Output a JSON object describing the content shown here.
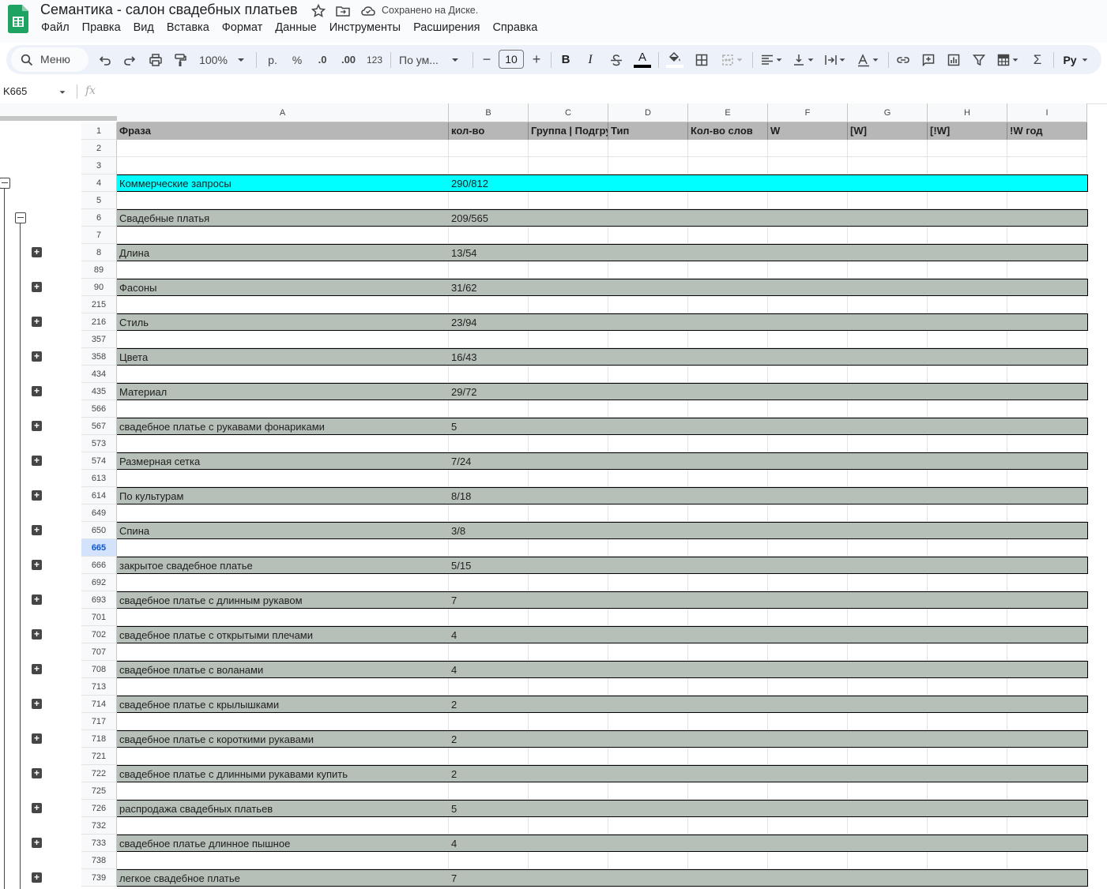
{
  "app": {
    "title": "Семантика - салон свадебных платьев",
    "saved_status": "Сохранено на Диске."
  },
  "menu": [
    "Файл",
    "Правка",
    "Вид",
    "Вставка",
    "Формат",
    "Данные",
    "Инструменты",
    "Расширения",
    "Справка"
  ],
  "toolbar": {
    "search_label": "Меню",
    "zoom": "100%",
    "currency": "р.",
    "percent": "%",
    "dec_decrease": ".0",
    "dec_increase": ".00",
    "number_format": "123",
    "font_name": "По ум...",
    "font_size": "10",
    "minus": "−",
    "plus": "+",
    "bold": "B",
    "italic": "I",
    "text_color_letter": "A",
    "sigma": "Σ",
    "input_tools": "Ру"
  },
  "formula_bar": {
    "name_box": "K665",
    "fx": "fx"
  },
  "columns": [
    "A",
    "B",
    "C",
    "D",
    "E",
    "F",
    "G",
    "H",
    "I"
  ],
  "header_row": {
    "row_number": "1",
    "cells": [
      "Фраза",
      "кол-во",
      "Группа | Подгруппа",
      "Тип",
      "Кол-во слов",
      "W",
      "[W]",
      "[!W]",
      "!W год"
    ]
  },
  "rows": [
    {
      "n": "2",
      "type": "empty"
    },
    {
      "n": "3",
      "type": "empty"
    },
    {
      "n": "4",
      "type": "cyan",
      "a": "Коммерческие запросы",
      "b": "290/812"
    },
    {
      "n": "5",
      "type": "empty"
    },
    {
      "n": "6",
      "type": "gray",
      "a": "Свадебные платья",
      "b": "209/565"
    },
    {
      "n": "7",
      "type": "empty"
    },
    {
      "n": "8",
      "type": "gray",
      "a": "Длина",
      "b": "13/54"
    },
    {
      "n": "89",
      "type": "empty"
    },
    {
      "n": "90",
      "type": "gray",
      "a": "Фасоны",
      "b": "31/62"
    },
    {
      "n": "215",
      "type": "empty"
    },
    {
      "n": "216",
      "type": "gray",
      "a": "Стиль",
      "b": "23/94"
    },
    {
      "n": "357",
      "type": "empty"
    },
    {
      "n": "358",
      "type": "gray",
      "a": "Цвета",
      "b": "16/43"
    },
    {
      "n": "434",
      "type": "empty"
    },
    {
      "n": "435",
      "type": "gray",
      "a": "Материал",
      "b": "29/72"
    },
    {
      "n": "566",
      "type": "empty"
    },
    {
      "n": "567",
      "type": "gray",
      "a": "свадебное платье с рукавами фонариками",
      "b": "5"
    },
    {
      "n": "573",
      "type": "empty"
    },
    {
      "n": "574",
      "type": "gray",
      "a": "Размерная сетка",
      "b": "7/24"
    },
    {
      "n": "613",
      "type": "empty"
    },
    {
      "n": "614",
      "type": "gray",
      "a": "По культурам",
      "b": "8/18"
    },
    {
      "n": "649",
      "type": "empty"
    },
    {
      "n": "650",
      "type": "gray",
      "a": "Спина",
      "b": "3/8"
    },
    {
      "n": "665",
      "type": "empty",
      "active": true
    },
    {
      "n": "666",
      "type": "gray",
      "a": "закрытое свадебное платье",
      "b": "5/15"
    },
    {
      "n": "692",
      "type": "empty"
    },
    {
      "n": "693",
      "type": "gray",
      "a": "свадебное платье с длинным рукавом",
      "b": "7"
    },
    {
      "n": "701",
      "type": "empty"
    },
    {
      "n": "702",
      "type": "gray",
      "a": "свадебное платье с открытыми плечами",
      "b": "4"
    },
    {
      "n": "707",
      "type": "empty"
    },
    {
      "n": "708",
      "type": "gray",
      "a": "свадебное платье с воланами",
      "b": "4"
    },
    {
      "n": "713",
      "type": "empty"
    },
    {
      "n": "714",
      "type": "gray",
      "a": "свадебное платье с крылышками",
      "b": "2"
    },
    {
      "n": "717",
      "type": "empty"
    },
    {
      "n": "718",
      "type": "gray",
      "a": "свадебное платье с короткими рукавами",
      "b": "2"
    },
    {
      "n": "721",
      "type": "empty"
    },
    {
      "n": "722",
      "type": "gray",
      "a": "свадебное платье с длинными рукавами купить",
      "b": "2"
    },
    {
      "n": "725",
      "type": "empty"
    },
    {
      "n": "726",
      "type": "gray",
      "a": "распродажа свадебных платьев",
      "b": "5"
    },
    {
      "n": "732",
      "type": "empty"
    },
    {
      "n": "733",
      "type": "gray",
      "a": "свадебное платье длинное пышное",
      "b": "4"
    },
    {
      "n": "738",
      "type": "empty"
    },
    {
      "n": "739",
      "type": "gray",
      "a": "легкое свадебное платье",
      "b": "7"
    }
  ],
  "colors": {
    "cyan_band": "#00ffff",
    "gray_band": "#b7c0b8",
    "header_fill": "#b7b7b7",
    "active_row": "#d3e3fd",
    "logo_green": "#1ea362"
  }
}
